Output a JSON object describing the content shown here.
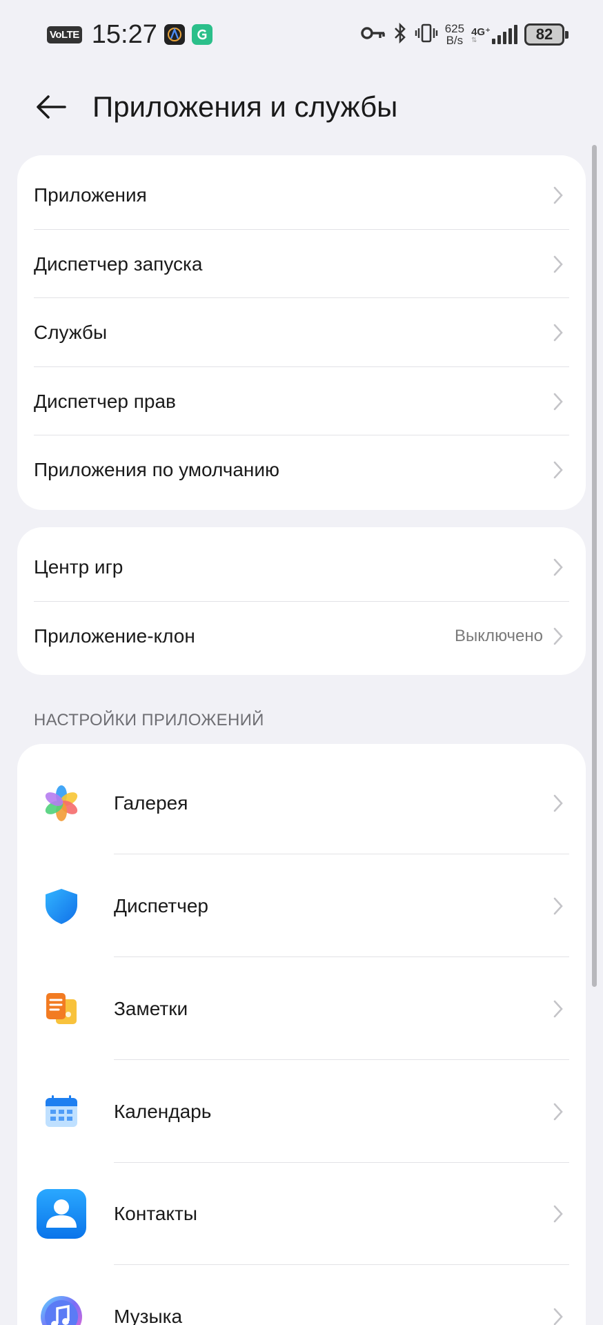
{
  "status_bar": {
    "volte": "VoLTE",
    "time": "15:27",
    "net_speed_value": "625",
    "net_speed_unit": "B/s",
    "network_type": "4G⁺",
    "battery": "82",
    "icons": [
      "vpn-key-icon",
      "bluetooth-icon",
      "vibrate-icon",
      "signal-icon"
    ]
  },
  "header": {
    "title": "Приложения и службы"
  },
  "group1": {
    "items": [
      {
        "label": "Приложения"
      },
      {
        "label": "Диспетчер запуска"
      },
      {
        "label": "Службы"
      },
      {
        "label": "Диспетчер прав"
      },
      {
        "label": "Приложения по умолчанию"
      }
    ]
  },
  "group2": {
    "items": [
      {
        "label": "Центр игр",
        "value": ""
      },
      {
        "label": "Приложение-клон",
        "value": "Выключено"
      }
    ]
  },
  "app_settings": {
    "section_title": "НАСТРОЙКИ ПРИЛОЖЕНИЙ",
    "items": [
      {
        "label": "Галерея",
        "icon": "gallery-icon"
      },
      {
        "label": "Диспетчер",
        "icon": "optimizer-shield-icon"
      },
      {
        "label": "Заметки",
        "icon": "notes-icon"
      },
      {
        "label": "Календарь",
        "icon": "calendar-icon"
      },
      {
        "label": "Контакты",
        "icon": "contacts-icon"
      },
      {
        "label": "Музыка",
        "icon": "music-icon"
      }
    ]
  },
  "colors": {
    "background": "#f1f1f6",
    "card": "#ffffff",
    "secondary_text": "#7a7a7a",
    "chevron": "#c4c4c8"
  }
}
